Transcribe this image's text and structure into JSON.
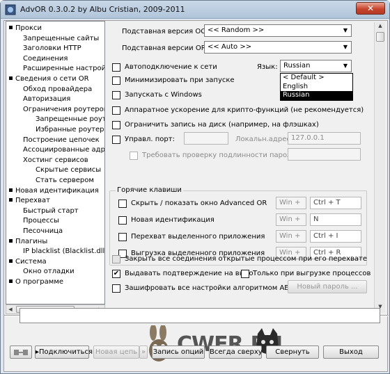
{
  "window": {
    "title": "AdvOR  0.3.0.2 by Albu Cristian, 2009-2011",
    "close_label": "✕"
  },
  "sidebar": {
    "items": [
      {
        "label": "Прокси",
        "level": 0,
        "bullet": true
      },
      {
        "label": "Запрещенные сайты",
        "level": 1
      },
      {
        "label": "Заголовки HTTP",
        "level": 1
      },
      {
        "label": "Соединения",
        "level": 1
      },
      {
        "label": "Расширенные настройки",
        "level": 1
      },
      {
        "label": "Сведения о сети OR",
        "level": 0,
        "bullet": true
      },
      {
        "label": "Обход провайдера",
        "level": 1
      },
      {
        "label": "Авторизация",
        "level": 1
      },
      {
        "label": "Ограничения роутеров",
        "level": 1
      },
      {
        "label": "Запрещенные роуте",
        "level": 2
      },
      {
        "label": "Избранные роутеры",
        "level": 2
      },
      {
        "label": "Построение цепочек",
        "level": 1
      },
      {
        "label": "Ассоциированные адрес",
        "level": 1
      },
      {
        "label": "Хостинг сервисов",
        "level": 1
      },
      {
        "label": "Скрытые сервисы",
        "level": 2
      },
      {
        "label": "Стать сервером",
        "level": 2
      },
      {
        "label": "Новая идентификация",
        "level": 0,
        "bullet": true
      },
      {
        "label": "Перехват",
        "level": 0,
        "bullet": true
      },
      {
        "label": "Быстрый старт",
        "level": 1
      },
      {
        "label": "Процессы",
        "level": 1
      },
      {
        "label": "Песочница",
        "level": 1
      },
      {
        "label": "Плагины",
        "level": 0,
        "bullet": true
      },
      {
        "label": "IP blacklist (Blacklist.dll)",
        "level": 1
      },
      {
        "label": "Система",
        "level": 0,
        "bullet": true
      },
      {
        "label": "Окно отладки",
        "level": 1
      },
      {
        "label": "О программе",
        "level": 0,
        "bullet": true
      }
    ],
    "selected_index": 23
  },
  "main": {
    "os_version_label": "Подставная версия ОС:",
    "os_version_value": "<< Random >>",
    "or_version_label": "Подставная версии OR:",
    "or_version_value": "<< Auto >>",
    "autoconnect_label": "Автоподключение к сети",
    "language_label": "Язык:",
    "language_value": "Russian",
    "language_options": [
      "< Default >",
      "English",
      "Russian"
    ],
    "minimize_label": "Минимизировать при запуске",
    "start_windows_label": "Запускать с Windows",
    "hw_accel_label": "Аппаратное ускорение для крипто-функций (не рекомендуется)",
    "limit_disk_label": "Ограничить запись на диск (например, на флэшках)",
    "control_port_label": "Управл. порт:",
    "local_addr_label": "Локальн.адрес:",
    "local_addr_value": "127.0.0.1",
    "require_auth_label": "Требовать проверку подлинности пароля:",
    "hotkeys_title": "Горячие клавиши",
    "hotkeys": [
      {
        "label": "Скрыть / показать окно Advanced OR",
        "modifier": "Win +",
        "key": "Ctrl + T"
      },
      {
        "label": "Новая идентификация",
        "modifier": "Win +",
        "key": "N"
      },
      {
        "label": "Перехват выделенного приложения",
        "modifier": "Win +",
        "key": "Ctrl + I"
      },
      {
        "label": "Выгрузка выделенного приложения",
        "modifier": "Win +",
        "key": "Ctrl + R"
      }
    ],
    "close_conn_label": "Закрыть все соединения открытые процессом при его перехвате",
    "confirm_exit_label": "Выдавать подтверждение на выхо",
    "only_unload_label": "Только при выгрузке процессов",
    "encrypt_label": "Зашифровать все настройки алгоритмом AES",
    "new_password_label": "Новый пароль ..."
  },
  "bottom": {
    "banner_text": "CWER.RU",
    "connect_label": "Подключиться",
    "new_chain_label": "Новая цепь",
    "save_label": "Запись опций",
    "on_top_label": "Всегда сверху",
    "minimize_label": "Свернуть",
    "exit_label": "Выход"
  }
}
